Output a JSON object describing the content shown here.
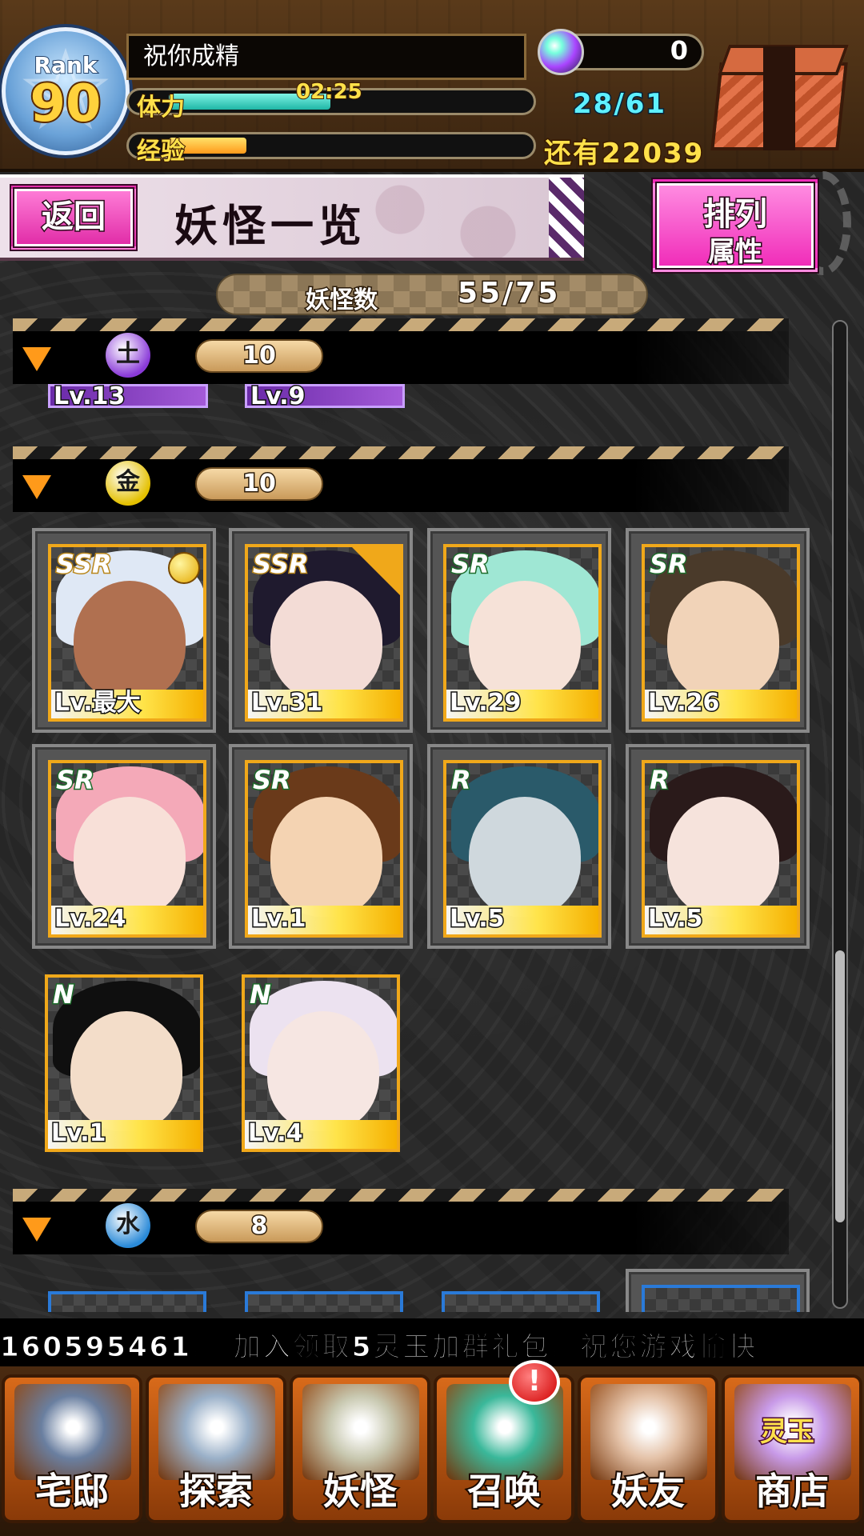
{
  "header": {
    "rank_label": "Rank",
    "rank_value": "90",
    "player_name": "祝你成精",
    "stamina_label": "体力",
    "stamina_timer": "02:25",
    "stamina_value": "28/61",
    "stamina_fill": 0.46,
    "exp_label": "经验",
    "exp_fill": 0.22,
    "remaining": "还有22039",
    "gem_count": "0"
  },
  "title_bar": {
    "back_label": "返回",
    "page_title": "妖怪一览",
    "sort_label_1": "排列",
    "sort_label_2": "属性"
  },
  "monster_count": {
    "label": "妖怪数",
    "value": "55/75"
  },
  "groups": [
    {
      "attr_icon": "earth-attribute-icon",
      "count": "10",
      "color": "#8a3ad8"
    },
    {
      "attr_icon": "gold-attribute-icon",
      "count": "10",
      "color": "#e4c000"
    },
    {
      "attr_icon": "water-attribute-icon",
      "count": "8",
      "color": "#2a8ad8"
    }
  ],
  "partial_cards": [
    {
      "level": "Lv.13"
    },
    {
      "level": "Lv.9"
    }
  ],
  "cards": [
    {
      "rarity": "SSR",
      "level": "Lv.最大",
      "hair": "#dfe8f5",
      "skin": "#b07050",
      "badge": "medal-icon"
    },
    {
      "rarity": "SSR",
      "level": "Lv.31",
      "hair": "#1f1a2e",
      "skin": "#f3dcd6",
      "badge": "star-icon"
    },
    {
      "rarity": "SR",
      "level": "Lv.29",
      "hair": "#9fe7d4",
      "skin": "#f6e2d8",
      "badge": ""
    },
    {
      "rarity": "SR",
      "level": "Lv.26",
      "hair": "#4a3a2a",
      "skin": "#f1d3b8",
      "badge": ""
    },
    {
      "rarity": "SR",
      "level": "Lv.24",
      "hair": "#f4a9b8",
      "skin": "#f8e0d8",
      "badge": ""
    },
    {
      "rarity": "SR",
      "level": "Lv.1",
      "hair": "#6a3a1a",
      "skin": "#f4d3b2",
      "badge": ""
    },
    {
      "rarity": "R",
      "level": "Lv.5",
      "hair": "#2a5a6a",
      "skin": "#cfd8dd",
      "badge": ""
    },
    {
      "rarity": "R",
      "level": "Lv.5",
      "hair": "#2a1a1a",
      "skin": "#f6e3dc",
      "badge": ""
    },
    {
      "rarity": "N",
      "level": "Lv.1",
      "hair": "#0f0f0f",
      "skin": "#f3ddc9",
      "badge": ""
    },
    {
      "rarity": "N",
      "level": "Lv.4",
      "hair": "#ece2f0",
      "skin": "#f6e6e2",
      "badge": ""
    }
  ],
  "ticker": "160595461。    加入领取5灵玉加群礼包。祝您游戏愉快",
  "nav": [
    {
      "label": "宅邸",
      "icon": "mansion-icon",
      "color": "#6a7fa0"
    },
    {
      "label": "探索",
      "icon": "magnifier-icon",
      "color": "#9ab0c8"
    },
    {
      "label": "妖怪",
      "icon": "scroll-icon",
      "color": "#c8c8b0"
    },
    {
      "label": "召唤",
      "icon": "pentagram-icon",
      "color": "#3ab89a"
    },
    {
      "label": "妖友",
      "icon": "friend-icon",
      "color": "#e4c2a8"
    },
    {
      "label": "商店",
      "icon": "spirit-orb-icon",
      "color": "#c89ae8"
    }
  ],
  "shop_orb_label": "灵玉",
  "alert": "!"
}
